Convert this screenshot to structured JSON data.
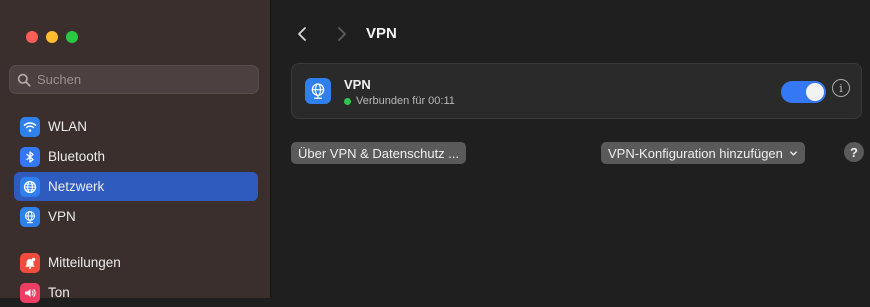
{
  "sidebar": {
    "search": {
      "placeholder": "Suchen",
      "value": ""
    },
    "items": [
      {
        "label": "WLAN",
        "icon": "wifi-icon"
      },
      {
        "label": "Bluetooth",
        "icon": "bluetooth-icon"
      },
      {
        "label": "Netzwerk",
        "icon": "globe-icon",
        "active": true
      },
      {
        "label": "VPN",
        "icon": "vpn-globe-icon"
      },
      {
        "label": "Mitteilungen",
        "icon": "bell-icon"
      },
      {
        "label": "Ton",
        "icon": "speaker-icon"
      }
    ]
  },
  "header": {
    "title": "VPN"
  },
  "vpn": {
    "name": "VPN",
    "status": "Verbunden für 00:11",
    "connected": true,
    "info_glyph": "i"
  },
  "actions": {
    "privacy_label": "Über VPN & Datenschutz ...",
    "add_config_label": "VPN-Konfiguration hinzufügen",
    "help_label": "?"
  },
  "colors": {
    "accent": "#2f5bbf",
    "toggle_on": "#3478f6",
    "status_green": "#30c552",
    "sidebar_bg": "#3b2f2e"
  }
}
